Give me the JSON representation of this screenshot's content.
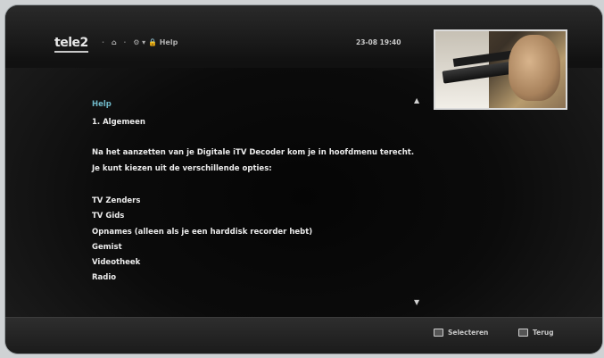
{
  "header": {
    "logo": "tele2",
    "breadcrumb": [
      "⌂",
      "⚙ ▾ 🔒 Help"
    ],
    "datetime": "23-08 19:40"
  },
  "content": {
    "section_title": "Help",
    "heading": "1. Algemeen",
    "intro": "Na het aanzetten van je Digitale iTV Decoder kom je in hoofdmenu terecht. Je kunt kiezen uit de verschillende opties:",
    "options": [
      "TV Zenders",
      "TV Gids",
      "Opnames (alleen als je een harddisk recorder hebt)",
      "Gemist",
      "Videotheek",
      "Radio"
    ]
  },
  "scroll": {
    "up": "▲",
    "down": "▼"
  },
  "footer": {
    "select_label": "Selecteren",
    "back_label": "Terug"
  }
}
